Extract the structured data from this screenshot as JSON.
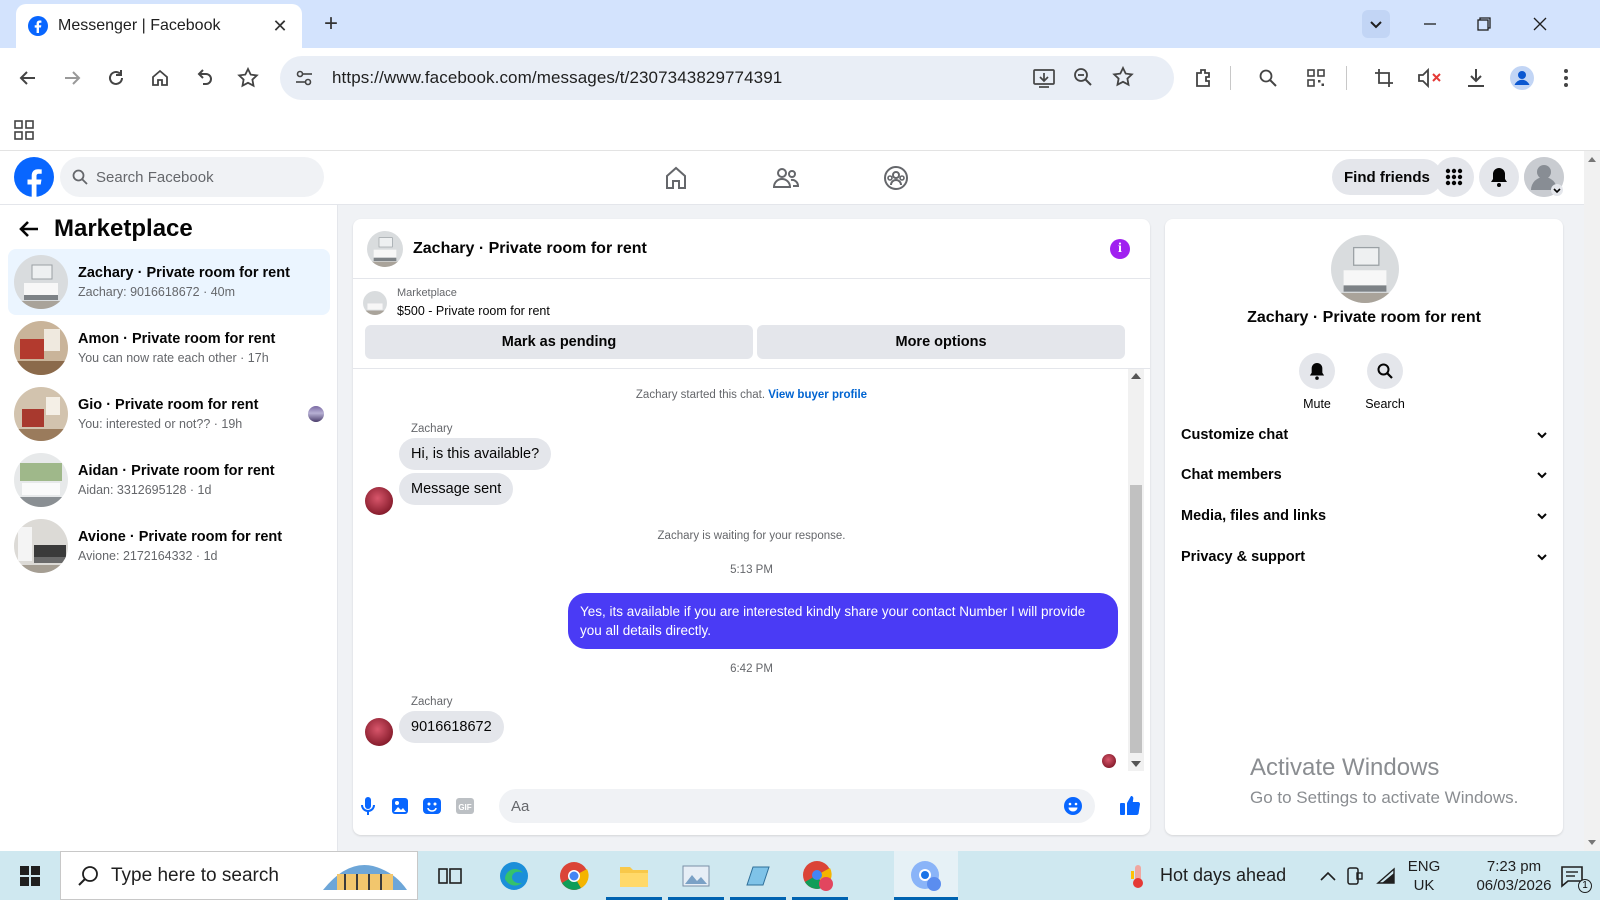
{
  "browser": {
    "tab_title": "Messenger | Facebook",
    "url": "https://www.facebook.com/messages/t/2307343829774391"
  },
  "facebook": {
    "search_placeholder": "Search Facebook",
    "find_friends_label": "Find friends"
  },
  "sidebar": {
    "title": "Marketplace",
    "conversations": [
      {
        "name": "Zachary · Private room for rent",
        "preview": "Zachary: 9016618672 · 40m"
      },
      {
        "name": "Amon · Private room for rent",
        "preview": "You can now rate each other · 17h"
      },
      {
        "name": "Gio · Private room for rent",
        "preview": "You: interested or not?? · 19h"
      },
      {
        "name": "Aidan · Private room for rent",
        "preview": "Aidan: 3312695128 · 1d"
      },
      {
        "name": "Avione · Private room for rent",
        "preview": "Avione: 2172164332 · 1d"
      }
    ]
  },
  "chat": {
    "title": "Zachary · Private room for rent",
    "listing_category": "Marketplace",
    "listing_title": "$500 - Private room for rent",
    "mark_pending_label": "Mark as pending",
    "more_options_label": "More options",
    "started_text": "Zachary started this chat.",
    "view_profile_link": "View buyer profile",
    "sender_name": "Zachary",
    "msg1": "Hi, is this available?",
    "msg2": "Message sent",
    "waiting_text": "Zachary is waiting for your response.",
    "time1": "5:13 PM",
    "out_msg": "Yes, its available if you are interested kindly share your contact Number I will provide you all details directly.",
    "time2": "6:42 PM",
    "sender_name2": "Zachary",
    "msg3": "9016618672",
    "composer_placeholder": "Aa"
  },
  "details": {
    "name": "Zachary · Private room for rent",
    "mute_label": "Mute",
    "search_label": "Search",
    "sections": [
      "Customize chat",
      "Chat members",
      "Media, files and links",
      "Privacy & support"
    ]
  },
  "watermark": {
    "line1": "Activate Windows",
    "line2": "Go to Settings to activate Windows."
  },
  "taskbar": {
    "search_placeholder": "Type here to search",
    "weather": "Hot days ahead",
    "lang1": "ENG",
    "lang2": "UK",
    "time": "7:23 pm",
    "date": "06/03/2026",
    "notification_count": "1"
  },
  "colors": {
    "facebook_blue": "#0866ff",
    "messenger_purple": "#4a3bf5",
    "info_purple": "#a020f0"
  }
}
